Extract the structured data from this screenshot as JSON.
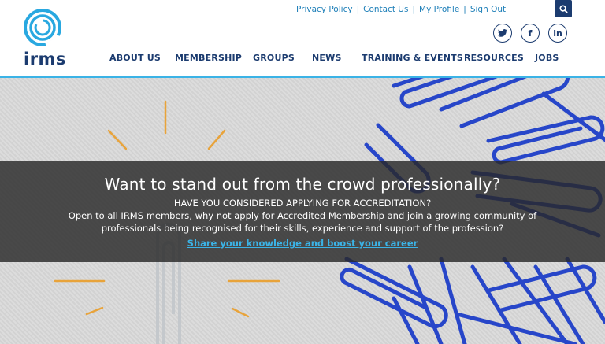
{
  "brand": {
    "logo_text": "irms",
    "accent": "#3bb3e6",
    "navy": "#1b3b6f"
  },
  "utility_nav": {
    "links": [
      "Privacy Policy",
      "Contact Us",
      "My Profile",
      "Sign Out"
    ],
    "separator": "|"
  },
  "search": {
    "icon": "search-icon"
  },
  "social": [
    {
      "icon": "twitter-icon",
      "glyph": "t"
    },
    {
      "icon": "facebook-icon",
      "glyph": "f"
    },
    {
      "icon": "linkedin-icon",
      "glyph": "in"
    }
  ],
  "main_nav": {
    "items": [
      "ABOUT US",
      "MEMBERSHIP",
      "GROUPS",
      "NEWS",
      "TRAINING & EVENTS",
      "RESOURCES",
      "JOBS"
    ]
  },
  "hero": {
    "headline": "Want to stand out from the crowd professionally?",
    "subheading": "HAVE YOU CONSIDERED APPLYING FOR ACCREDITATION?",
    "body_line1": "Open to all IRMS members, why not apply for Accredited Membership and join a growing community of",
    "body_line2": "professionals being recognised for their skills, experience and support of the profession?",
    "cta": "Share your knowledge and boost your career"
  }
}
